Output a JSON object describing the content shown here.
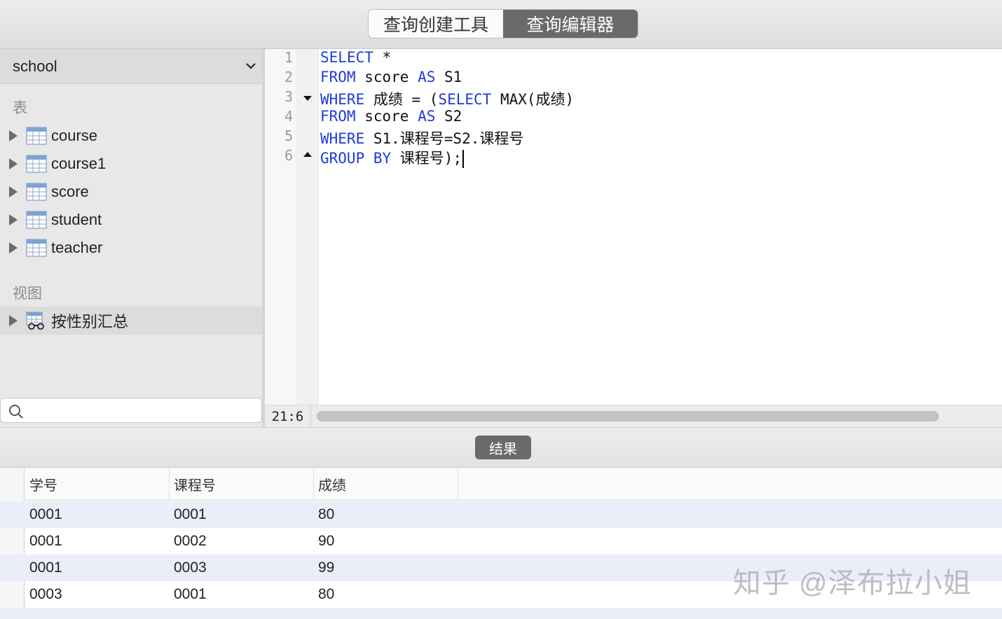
{
  "toolbar": {
    "tabs": [
      {
        "label": "查询创建工具",
        "active": false
      },
      {
        "label": "查询编辑器",
        "active": true
      }
    ]
  },
  "sidebar": {
    "database": "school",
    "tables_heading": "表",
    "tables": [
      "course",
      "course1",
      "score",
      "student",
      "teacher"
    ],
    "views_heading": "视图",
    "views": [
      "按性别汇总"
    ],
    "search_placeholder": ""
  },
  "editor": {
    "line_numbers": [
      "1",
      "2",
      "3",
      "4",
      "5",
      "6"
    ],
    "lines": [
      [
        {
          "t": "SELECT",
          "k": true
        },
        {
          "t": " *",
          "k": false
        }
      ],
      [
        {
          "t": "FROM",
          "k": true
        },
        {
          "t": " score ",
          "k": false
        },
        {
          "t": "AS",
          "k": true
        },
        {
          "t": " S1",
          "k": false
        }
      ],
      [
        {
          "t": "WHERE",
          "k": true
        },
        {
          "t": " 成绩 = (",
          "k": false
        },
        {
          "t": "SELECT",
          "k": true
        },
        {
          "t": " MAX(成绩)",
          "k": false
        }
      ],
      [
        {
          "t": "FROM",
          "k": true
        },
        {
          "t": " score ",
          "k": false
        },
        {
          "t": "AS",
          "k": true
        },
        {
          "t": " S2",
          "k": false
        }
      ],
      [
        {
          "t": "WHERE",
          "k": true
        },
        {
          "t": " S1.课程号=S2.课程号",
          "k": false
        }
      ],
      [
        {
          "t": "GROUP BY",
          "k": true
        },
        {
          "t": " 课程号);",
          "k": false
        }
      ]
    ],
    "cursor_position": "21:6"
  },
  "results": {
    "button_label": "结果",
    "columns": [
      "学号",
      "课程号",
      "成绩"
    ],
    "rows": [
      [
        "0001",
        "0001",
        "80"
      ],
      [
        "0001",
        "0002",
        "90"
      ],
      [
        "0001",
        "0003",
        "99"
      ],
      [
        "0003",
        "0001",
        "80"
      ]
    ]
  },
  "watermark": "知乎 @泽布拉小姐",
  "colors": {
    "keyword": "#1f3bd8",
    "active_tab": "#6a6a6a",
    "alt_row": "#eaeef9"
  }
}
